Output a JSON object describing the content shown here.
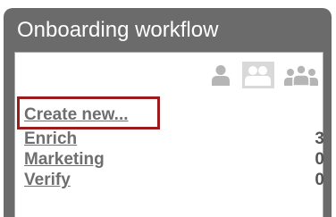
{
  "panel": {
    "title": "Onboarding workflow"
  },
  "view_toggle": {
    "options": [
      {
        "icon": "single-user-icon",
        "selected": false
      },
      {
        "icon": "two-users-icon",
        "selected": true
      },
      {
        "icon": "user-group-icon",
        "selected": false
      }
    ]
  },
  "create_link": "Create new...",
  "workflows": [
    {
      "name": "Enrich",
      "count": "3"
    },
    {
      "name": "Marketing",
      "count": "0"
    },
    {
      "name": "Verify",
      "count": "0"
    }
  ],
  "colors": {
    "header": "#6b6b6b",
    "link": "#6e6e6e",
    "highlight": "#9b1c1c",
    "icon": "#b5b5b5"
  }
}
